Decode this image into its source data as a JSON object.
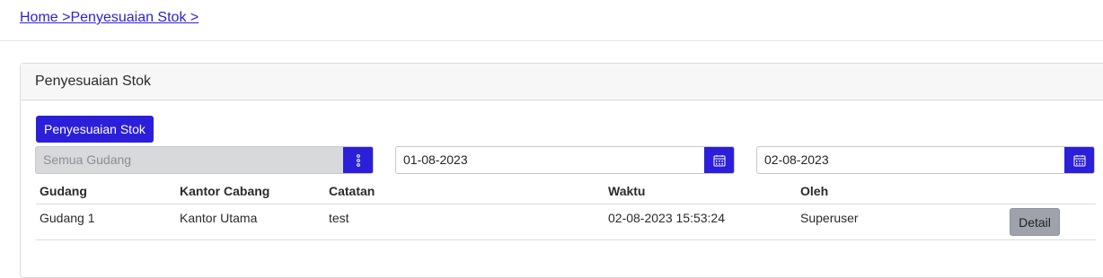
{
  "breadcrumb": {
    "text": "Home >Penyesuaian Stok >"
  },
  "card": {
    "title": "Penyesuaian Stok"
  },
  "toolbar": {
    "primary_button_label": "Penyesuaian Stok"
  },
  "filters": {
    "warehouse": {
      "placeholder": "Semua Gudang",
      "icon": "vertical-dots-icon"
    },
    "date_from": {
      "value": "01-08-2023",
      "icon": "calendar-icon"
    },
    "date_to": {
      "value": "02-08-2023",
      "icon": "calendar-icon"
    }
  },
  "table": {
    "columns": [
      "Gudang",
      "Kantor Cabang",
      "Catatan",
      "Waktu",
      "Oleh"
    ],
    "rows": [
      {
        "gudang": "Gudang 1",
        "kantor_cabang": "Kantor Utama",
        "catatan": "test",
        "waktu": "02-08-2023 15:53:24",
        "oleh": "Superuser",
        "action_label": "Detail"
      }
    ]
  },
  "colors": {
    "primary": "#2b1fd9",
    "link": "#2b23d6",
    "secondary_button": "#9ea3ab"
  }
}
